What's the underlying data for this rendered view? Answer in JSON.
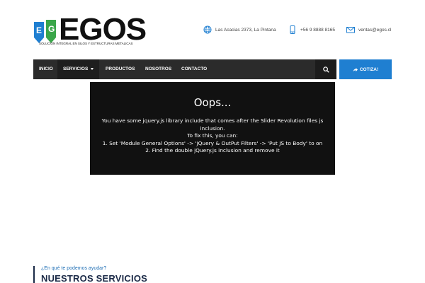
{
  "brand": {
    "name": "EGOS",
    "tagline": "SOLUCION INTEGRAL EN SILOS Y ESTRUCTURAS METALICAS",
    "logo_colors": [
      "#1f7fd1",
      "#3aa64a"
    ]
  },
  "contact": {
    "address": "Las Acacias 2373, La Pintana",
    "phone": "+56 9 8888 8165",
    "email": "ventas@egos.cl"
  },
  "nav": {
    "items": [
      {
        "label": "INICIO"
      },
      {
        "label": "SERVICIOS"
      },
      {
        "label": "PRODUCTOS"
      },
      {
        "label": "NOSOTROS"
      },
      {
        "label": "CONTACTO"
      }
    ],
    "cta_label": "COTIZA!",
    "cta_color": "#1f7fd1"
  },
  "error": {
    "title": "Oops...",
    "message": "You have some jquery.js library include that comes after the Slider Revolution files js inclusion.",
    "fix_intro": "To fix this, you can:",
    "step1": "1. Set 'Module General Options' -> 'jQuery & OutPut Filters' -> 'Put JS to Body' to on",
    "step2": "2. Find the double jQuery.js inclusion and remove it"
  },
  "services": {
    "subtitle": "¿En qué te podemos ayudar?",
    "title": "NUESTROS SERVICIOS"
  }
}
